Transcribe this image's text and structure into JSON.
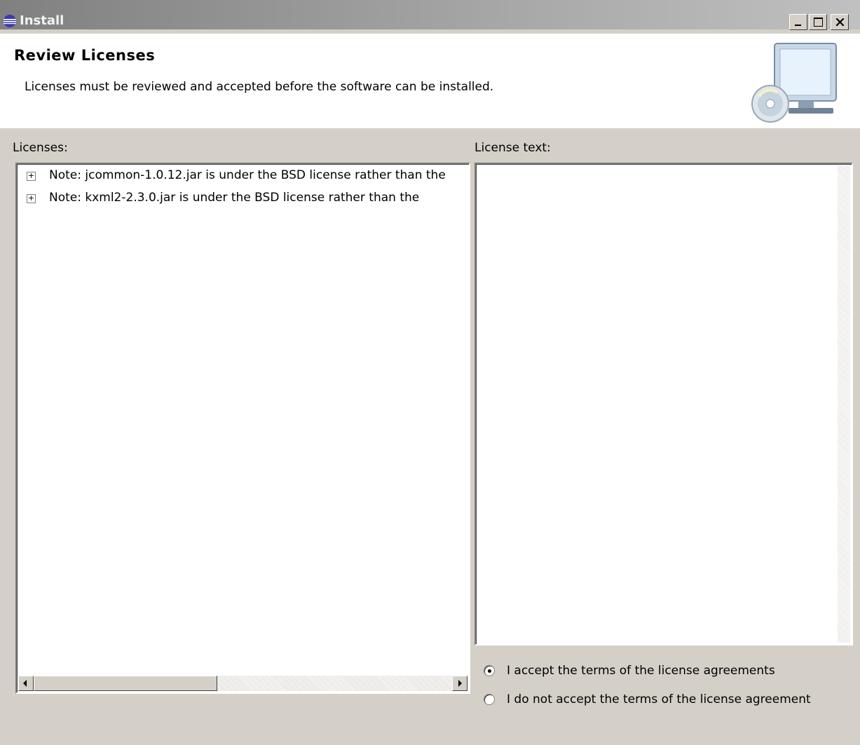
{
  "window": {
    "title": "Install",
    "controls": {
      "minimize": "_",
      "maximize": "□",
      "close": "×"
    }
  },
  "header": {
    "title": "Review Licenses",
    "description": "Licenses must be reviewed and accepted before the software can be installed."
  },
  "licenses": {
    "label": "Licenses:",
    "items": [
      {
        "expander": "+",
        "text": "Note:  jcommon-1.0.12.jar is under the BSD license rather than the"
      },
      {
        "expander": "+",
        "text": "Note:  kxml2-2.3.0.jar is under the BSD license rather than the"
      }
    ]
  },
  "license_text": {
    "label": "License text:",
    "content": ""
  },
  "agreement": {
    "accept_label": "I accept the terms of the license agreements",
    "decline_label": "I do not accept the terms of the license agreement",
    "selected": "accept"
  }
}
